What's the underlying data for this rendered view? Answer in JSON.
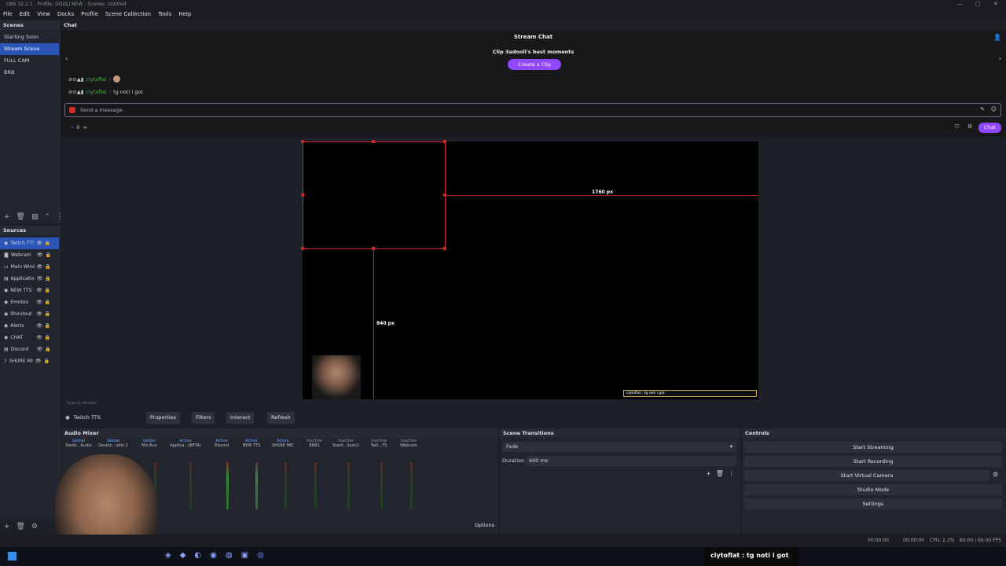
{
  "window": {
    "title": "OBS 32.2.1 - Profile: DOOLI NEW - Scenes: Untitled"
  },
  "menu": [
    "File",
    "Edit",
    "View",
    "Docks",
    "Profile",
    "Scene Collection",
    "Tools",
    "Help"
  ],
  "scenes": {
    "header": "Scenes",
    "items": [
      "Starting Soon",
      "Stream Scene",
      "FULL CAM",
      "BRB"
    ],
    "active_index": 1
  },
  "sources": {
    "header": "Sources",
    "items": [
      "Twitch TTS",
      "Webcam",
      "Main Window",
      "Application",
      "NEW TTS",
      "Emotes",
      "Shoutout",
      "Alerts",
      "CHAT",
      "Discord",
      "SHURE MIC"
    ]
  },
  "chat": {
    "dock_title": "Chat",
    "header": "Stream Chat",
    "clip_title": "Clip 3adooli's best moments",
    "clip_button": "Create a Clip",
    "messages": [
      {
        "user": "clytoflat",
        "text": ""
      },
      {
        "user": "clytoflat",
        "text": "tg noti i got"
      }
    ],
    "input_placeholder": "Send a message",
    "points": "0",
    "send_button": "Chat",
    "user_color": "#4caf50"
  },
  "preview": {
    "width_label": "1760 px",
    "height_label": "840 px",
    "overlay_text": "clytoflat : tg noti i got",
    "zoom": "Scale to Window"
  },
  "source_toolbar": {
    "source": "Twitch TTS",
    "properties": "Properties",
    "filters": "Filters",
    "interact": "Interact",
    "refresh": "Refresh"
  },
  "mixer": {
    "header": "Audio Mixer",
    "channels": [
      {
        "name": "Deskt...Audio",
        "tag": "Global"
      },
      {
        "name": "Deskto...udio 2",
        "tag": "Global"
      },
      {
        "name": "Mic/Aux",
        "tag": "Global"
      },
      {
        "name": "Applica...(BETA)",
        "tag": "Active"
      },
      {
        "name": "Discord",
        "tag": "Active"
      },
      {
        "name": "NEW TTS",
        "tag": "Active"
      },
      {
        "name": "SHURE MIC",
        "tag": "Active"
      },
      {
        "name": "BRB1",
        "tag": "Inactive"
      },
      {
        "name": "Starti...Soon1",
        "tag": "Inactive"
      },
      {
        "name": "Twit...TS",
        "tag": "Inactive"
      },
      {
        "name": "Webcam",
        "tag": "Inactive"
      }
    ],
    "options": "Options"
  },
  "transitions": {
    "header": "Scene Transitions",
    "selected": "Fade",
    "duration_label": "Duration",
    "duration_value": "600 ms"
  },
  "controls": {
    "header": "Controls",
    "buttons": [
      "Start Streaming",
      "Start Recording",
      "Start Virtual Camera",
      "Studio Mode",
      "Settings"
    ]
  },
  "status": {
    "stream_time": "00:00:00",
    "rec_time": "00:00:00",
    "cpu": "CPU: 2.2%",
    "fps": "60.00 / 60.00 FPS"
  },
  "caption": "clytoflat : tg noti i got",
  "colors": {
    "accent": "#2b55b7",
    "twitch": "#9147ff",
    "selection": "#c8262b"
  }
}
